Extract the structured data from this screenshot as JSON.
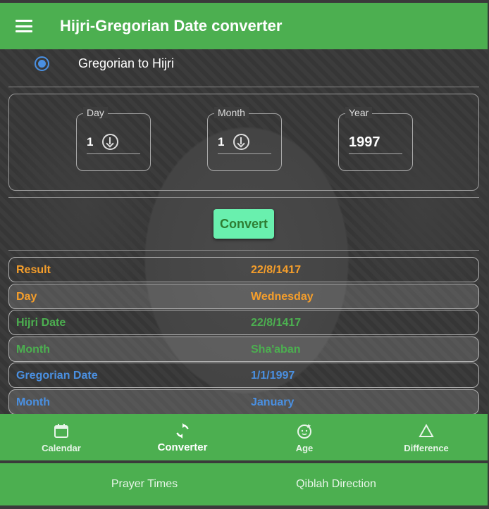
{
  "appbar": {
    "title": "Hijri-Gregorian Date converter",
    "menu_icon": "menu-icon"
  },
  "mode": {
    "label": "Gregorian to Hijri",
    "selected": true
  },
  "fields": {
    "day": {
      "label": "Day",
      "value": "1"
    },
    "month": {
      "label": "Month",
      "value": "1"
    },
    "year": {
      "label": "Year",
      "value": "1997"
    }
  },
  "convert_label": "Convert",
  "results": [
    {
      "key": "Result",
      "value": "22/8/1417",
      "color": "#f59e2b"
    },
    {
      "key": "Day",
      "value": "Wednesday",
      "color": "#f59e2b"
    },
    {
      "key": "Hijri Date",
      "value": "22/8/1417",
      "color": "#4caf50"
    },
    {
      "key": "Month",
      "value": "Sha'aban",
      "color": "#4caf50"
    },
    {
      "key": "Gregorian Date",
      "value": "1/1/1997",
      "color": "#4a90e2"
    },
    {
      "key": "Month",
      "value": "January",
      "color": "#4a90e2"
    }
  ],
  "nav": [
    {
      "label": "Calendar",
      "icon": "calendar-icon",
      "active": false
    },
    {
      "label": "Converter",
      "icon": "refresh-icon",
      "active": true
    },
    {
      "label": "Age",
      "icon": "baby-face-icon",
      "active": false
    },
    {
      "label": "Difference",
      "icon": "triangle-delta-icon",
      "active": false
    }
  ],
  "bottom_buttons": {
    "prayer": "Prayer Times",
    "qiblah": "Qiblah Direction"
  },
  "colors": {
    "primary": "#4caf50",
    "accent": "#69f0ae",
    "radio": "#4a90e2"
  }
}
